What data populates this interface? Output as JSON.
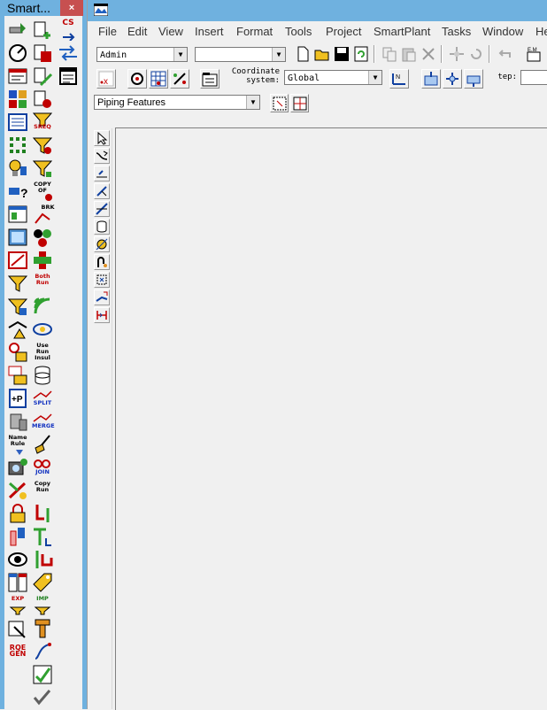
{
  "toolbox": {
    "title": "Smart...",
    "close_glyph": "×",
    "labels": {
      "cs": "CS",
      "sreq": "SREQ",
      "copy_of": "COPY OF",
      "brk": "BRK",
      "both_run": "Both Run",
      "use_run_insul": "Use Run Insul",
      "split": "SPLIT",
      "merge": "MERGE",
      "name_rule": "Name Rule",
      "join": "JOIN",
      "copy_run": "Copy Run",
      "exp": "EXP",
      "imp": "IMP",
      "rqe_gen": "RQE GEN"
    }
  },
  "menubar": {
    "items": [
      "File",
      "Edit",
      "View",
      "Insert",
      "Format",
      "Tools",
      "Project",
      "SmartPlant",
      "Tasks",
      "Window",
      "He"
    ]
  },
  "toolbar1": {
    "user_combo": "Admin",
    "blank_combo": ""
  },
  "toolbar2": {
    "coord_label_line1": "Coordinate",
    "coord_label_line2": "system:",
    "coord_combo": "Global",
    "step_label": "tep:",
    "step_value": ""
  },
  "toolbar3": {
    "features_combo": "Piping Features"
  },
  "colors": {
    "titlebar": "#6fb1df",
    "close": "#c75050"
  }
}
